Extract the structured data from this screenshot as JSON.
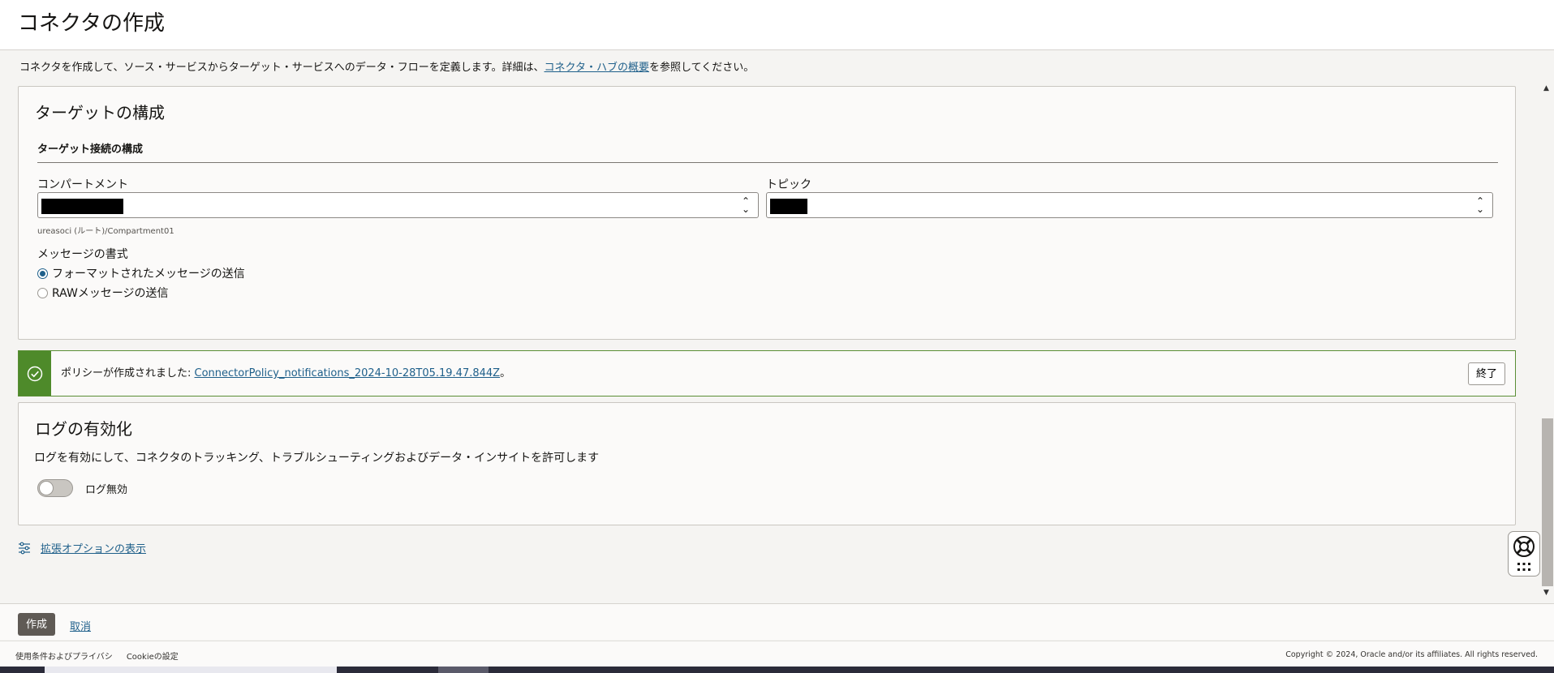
{
  "page": {
    "title": "コネクタの作成",
    "description_prefix": "コネクタを作成して、ソース・サービスからターゲット・サービスへのデータ・フローを定義します。詳細は、",
    "description_link": "コネクタ・ハブの概要",
    "description_suffix": "を参照してください。"
  },
  "target": {
    "panel_title": "ターゲットの構成",
    "section_title": "ターゲット接続の構成",
    "compartment_label": "コンパートメント",
    "compartment_hint": "ureasoci (ルート)/Compartment01",
    "topic_label": "トピック",
    "format_label": "メッセージの書式",
    "format_options": [
      {
        "label": "フォーマットされたメッセージの送信",
        "selected": true
      },
      {
        "label": "RAWメッセージの送信",
        "selected": false
      }
    ]
  },
  "banner": {
    "prefix": "ポリシーが作成されました: ",
    "link": "ConnectorPolicy_notifications_2024-10-28T05.19.47.844Z",
    "suffix": "。",
    "close_label": "終了",
    "status_color": "#4e8a2a"
  },
  "logs": {
    "panel_title": "ログの有効化",
    "description": "ログを有効にして、コネクタのトラッキング、トラブルシューティングおよびデータ・インサイトを許可します",
    "toggle_label": "ログ無効",
    "toggle_on": false
  },
  "advanced": {
    "link": "拡張オプションの表示",
    "icon": "sliders-icon"
  },
  "footer": {
    "create_label": "作成",
    "cancel_label": "取消"
  },
  "legal": {
    "terms": "使用条件およびプライバシ",
    "cookies": "Cookieの設定",
    "copyright": "Copyright © 2024, Oracle and/or its affiliates. All rights reserved."
  },
  "colors": {
    "accent": "#1e5f8a",
    "primary_button": "#5f5a55",
    "success": "#4e8a2a"
  }
}
